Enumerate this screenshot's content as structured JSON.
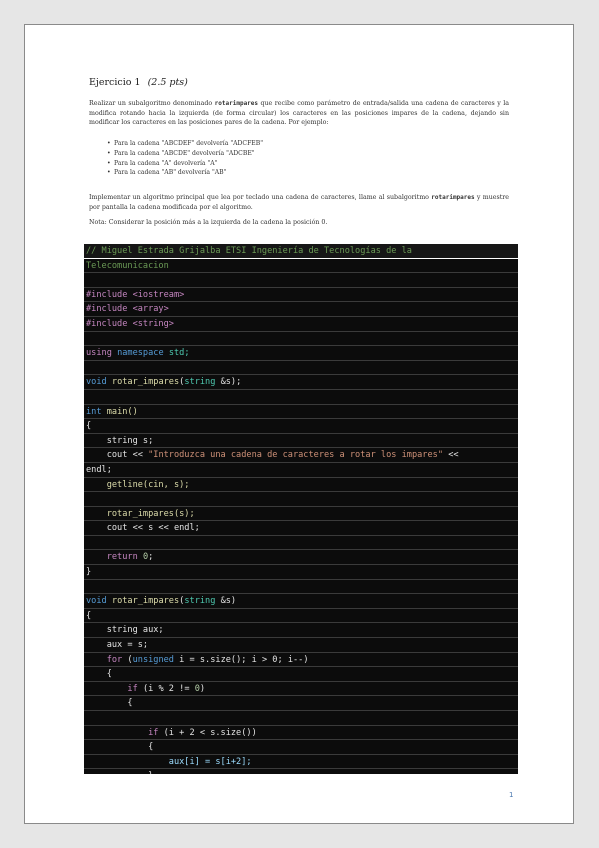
{
  "exercise": {
    "title": "Ejercicio 1",
    "points": "(2.5 pts)"
  },
  "intro": {
    "p1_a": "Realizar un subalgoritmo denominado ",
    "p1_code": "rotarimpares",
    "p1_b": " que recibe como parámetro de entrada/salida una cadena de caracteres y la modifica rotando hacia la izquierda (de forma circular) los caracteres en las posiciones impares de la cadena, dejando sin modificar los caracteres en las posiciones pares de la cadena. Por ejemplo:"
  },
  "examples": [
    "Para la cadena \"ABCDEF\" devolvería \"ADCFEB\"",
    "Para la cadena \"ABCDE\" devolvería \"ADCBE\"",
    "Para la cadena \"A\" devolvería \"A\"",
    "Para la cadena \"AB\" devolvería \"AB\""
  ],
  "main_para": {
    "a": "Implementar un algoritmo principal que lea por teclado una cadena de caracteres, llame al subalgoritmo ",
    "code": "rotarimpares",
    "b": " y muestre por pantalla la cadena modificada por el algoritmo."
  },
  "note": "Nota: Considerar la posición más a la izquierda de la cadena la posición 0.",
  "code": {
    "comment_line1": "// Miguel Estrada Grijalba ETSI Ingeniería de Tecnologías de la",
    "comment_line2": "Telecomunicacion",
    "include1": "#include <iostream>",
    "include2": "#include <array>",
    "include3": "#include <string>",
    "using": "using",
    "namespace": "namespace",
    "std": "std;",
    "void_kw": "void",
    "proto_fn": "rotar_impares",
    "proto_type": "string",
    "proto_rest": " &s);",
    "int_kw": "int",
    "main_sig": "main()",
    "open_brace": "{",
    "close_brace": "}",
    "decl_s": "    string s;",
    "cout_a": "    cout << ",
    "cout_str": "\"Introduzca una cadena de caracteres a rotar los impares\"",
    "cout_b": " <<",
    "endl_line": "endl;",
    "getline": "    getline(cin, s);",
    "call_rot": "    rotar_impares(s);",
    "cout_s": "    cout << s << endl;",
    "return_kw": "return",
    "return_num": "0",
    "impl_fn": "rotar_impares",
    "impl_type": "string",
    "impl_rest": " &s)",
    "decl_aux": "    string aux;",
    "assign_aux": "    aux = s;",
    "for_kw": "for",
    "for_rest_a": " (",
    "for_type": "unsigned",
    "for_rest_b": " i = s.size(); i > 0; i--)",
    "brace_l2": "    {",
    "if_kw": "if",
    "if1_rest_a": " (i % 2 != ",
    "if1_num": "0",
    "if1_rest_b": ")",
    "brace_l3": "        {",
    "if2_rest_a": " (i + 2 < s.size())",
    "brace_l4": "            {",
    "assign_line": "                aux[i] = s[i+2];",
    "brace_close_l4": "            }"
  },
  "page_number": "1"
}
